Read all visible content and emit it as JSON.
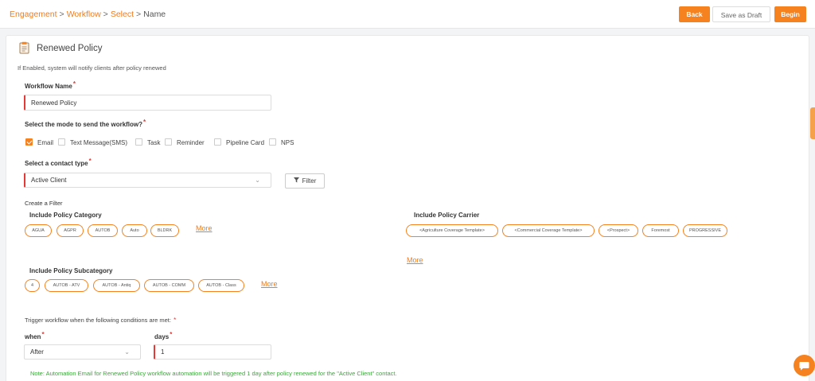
{
  "breadcrumb": {
    "items": [
      "Engagement",
      "Workflow",
      "Select"
    ],
    "current": "Name",
    "separator": ">"
  },
  "header_buttons": {
    "back": "Back",
    "save_draft": "Save as Draft",
    "begin": "Begin"
  },
  "page": {
    "title": "Renewed Policy",
    "description": "If Enabled, system will notify clients after policy renewed"
  },
  "workflow_name": {
    "label": "Workflow Name",
    "value": "Renewed Policy"
  },
  "mode": {
    "label": "Select the mode to send the workflow?",
    "options": [
      {
        "label": "Email",
        "checked": true
      },
      {
        "label": "Text Message(SMS)",
        "checked": false
      },
      {
        "label": "Task",
        "checked": false
      },
      {
        "label": "Reminder",
        "checked": false
      },
      {
        "label": "Pipeline Card",
        "checked": false
      },
      {
        "label": "NPS",
        "checked": false
      }
    ]
  },
  "contact_type": {
    "label": "Select a contact type",
    "value": "Active Client",
    "filter_label": "Filter"
  },
  "filter": {
    "heading": "Create a Filter",
    "policy_category": {
      "label": "Include Policy Category",
      "chips": [
        "AGUA",
        "AGPR",
        "AUTOB",
        "Auto",
        "BLDRK"
      ],
      "more": "More"
    },
    "policy_carrier": {
      "label": "Include Policy Carrier",
      "chips": [
        "<Agriculture Coverage Template>",
        "<Commercial Coverage Template>",
        "<Prospect>",
        "Foremost",
        "PROGRESSIVE"
      ],
      "more": "More"
    },
    "policy_subcategory": {
      "label": "Include Policy Subcategory",
      "chips": [
        "4",
        "AUTOB - ATV",
        "AUTOB - Antiq",
        "AUTOB - COMM",
        "AUTOB - Class"
      ],
      "more": "More"
    }
  },
  "trigger": {
    "label": "Trigger workflow when the following conditions are met:",
    "when_label": "when",
    "when_value": "After",
    "days_label": "days",
    "days_value": "1"
  },
  "note": "Note: Automation Email for Renewed Policy workflow automation will be triggered 1 day after policy renewed for the \"Active Client\" contact.",
  "colors": {
    "accent": "#f5821f",
    "required": "#e53935",
    "note": "#3aa83a"
  },
  "icons": {
    "page": "document-icon",
    "filter": "funnel-icon",
    "chat": "chat-bubble-icon"
  }
}
